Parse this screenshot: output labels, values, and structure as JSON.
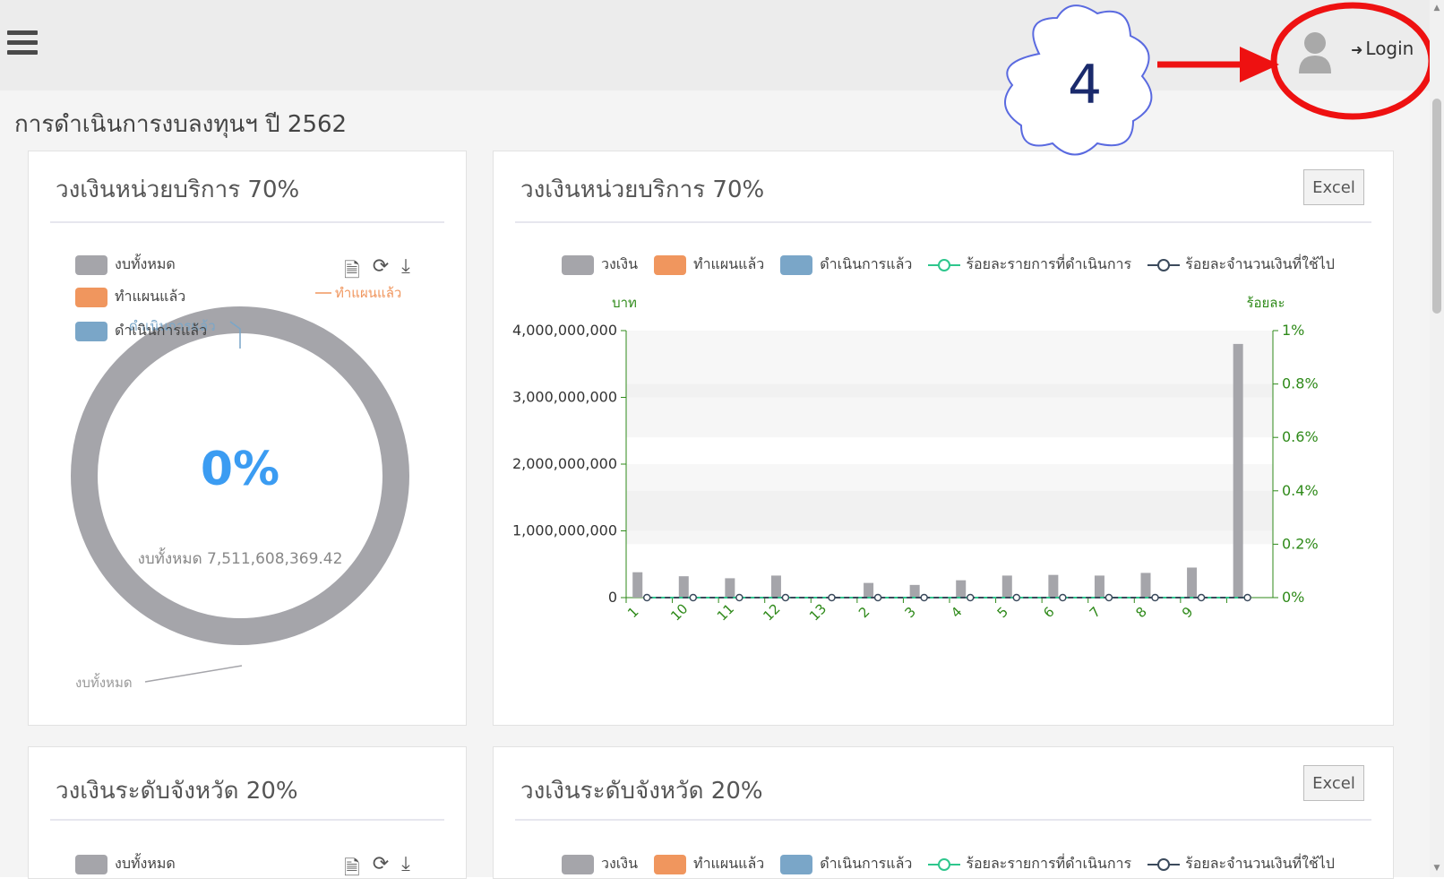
{
  "header": {
    "login_label": "Login"
  },
  "page": {
    "title": "การดำเนินการงบลงทุนฯ ปี 2562"
  },
  "annotation": {
    "step_number": "4"
  },
  "donut_card_1": {
    "title": "วงเงินหน่วยบริการ 70%",
    "legend": [
      "งบทั้งหมด",
      "ทำแผนแล้ว",
      "ดำเนินการแล้ว"
    ],
    "center_percent": "0%",
    "center_label": "งบทั้งหมด 7,511,608,369.42",
    "callout_planned": "ทำแผนแล้ว",
    "callout_done": "ดำเนินการแล้ว",
    "callout_total": "งบทั้งหมด"
  },
  "bar_card_1": {
    "title": "วงเงินหน่วยบริการ 70%",
    "excel_label": "Excel"
  },
  "donut_card_2": {
    "title": "วงเงินระดับจังหวัด 20%",
    "legend": [
      "งบทั้งหมด"
    ]
  },
  "bar_card_2": {
    "title": "วงเงินระดับจังหวัด 20%",
    "excel_label": "Excel",
    "legend": [
      "วงเงิน",
      "ทำแผนแล้ว",
      "ดำเนินการแล้ว",
      "ร้อยละรายการที่ดำเนินการ",
      "ร้อยละจำนวนเงินที่ใช้ไป"
    ]
  },
  "colors": {
    "total": "#a5a5aa",
    "planned": "#f0965e",
    "done": "#7aa6c8",
    "pct_items": "#2ec68d",
    "pct_money": "#3b4a5c",
    "center_percent": "#3b9cf2",
    "axis_green": "#2f8a1a"
  },
  "chart_data": [
    {
      "type": "bar",
      "title": "",
      "categories": [
        "1",
        "10",
        "11",
        "12",
        "13",
        "2",
        "3",
        "4",
        "5",
        "6",
        "7",
        "8",
        "9",
        ""
      ],
      "series": [
        {
          "name": "วงเงิน",
          "axis": "left",
          "values": [
            380000000,
            320000000,
            290000000,
            330000000,
            0,
            220000000,
            190000000,
            260000000,
            330000000,
            340000000,
            330000000,
            370000000,
            450000000,
            3800000000
          ]
        },
        {
          "name": "ทำแผนแล้ว",
          "axis": "left",
          "values": [
            0,
            0,
            0,
            0,
            0,
            0,
            0,
            0,
            0,
            0,
            0,
            0,
            0,
            0
          ]
        },
        {
          "name": "ดำเนินการแล้ว",
          "axis": "left",
          "values": [
            0,
            0,
            0,
            0,
            0,
            0,
            0,
            0,
            0,
            0,
            0,
            0,
            0,
            0
          ]
        },
        {
          "name": "ร้อยละรายการที่ดำเนินการ",
          "axis": "right",
          "type": "line",
          "values": [
            0,
            0,
            0,
            0,
            0,
            0,
            0,
            0,
            0,
            0,
            0,
            0,
            0,
            0
          ]
        },
        {
          "name": "ร้อยละจำนวนเงินที่ใช้ไป",
          "axis": "right",
          "type": "line",
          "values": [
            0,
            0,
            0,
            0,
            0,
            0,
            0,
            0,
            0,
            0,
            0,
            0,
            0,
            0
          ]
        }
      ],
      "ylabel": "บาท",
      "y2label": "ร้อยละ",
      "ylim": [
        0,
        4000000000
      ],
      "y_ticks": [
        "0",
        "1,000,000,000",
        "2,000,000,000",
        "3,000,000,000",
        "4,000,000,000"
      ],
      "y2lim": [
        0,
        1
      ],
      "y2_ticks": [
        "0%",
        "0.2%",
        "0.4%",
        "0.6%",
        "0.8%",
        "1%"
      ],
      "legend_position": "top"
    },
    {
      "type": "pie",
      "title": "",
      "slices": [
        {
          "label": "งบทั้งหมด",
          "value": 7511608369.42
        },
        {
          "label": "ทำแผนแล้ว",
          "value": 0
        },
        {
          "label": "ดำเนินการแล้ว",
          "value": 0
        }
      ]
    }
  ]
}
